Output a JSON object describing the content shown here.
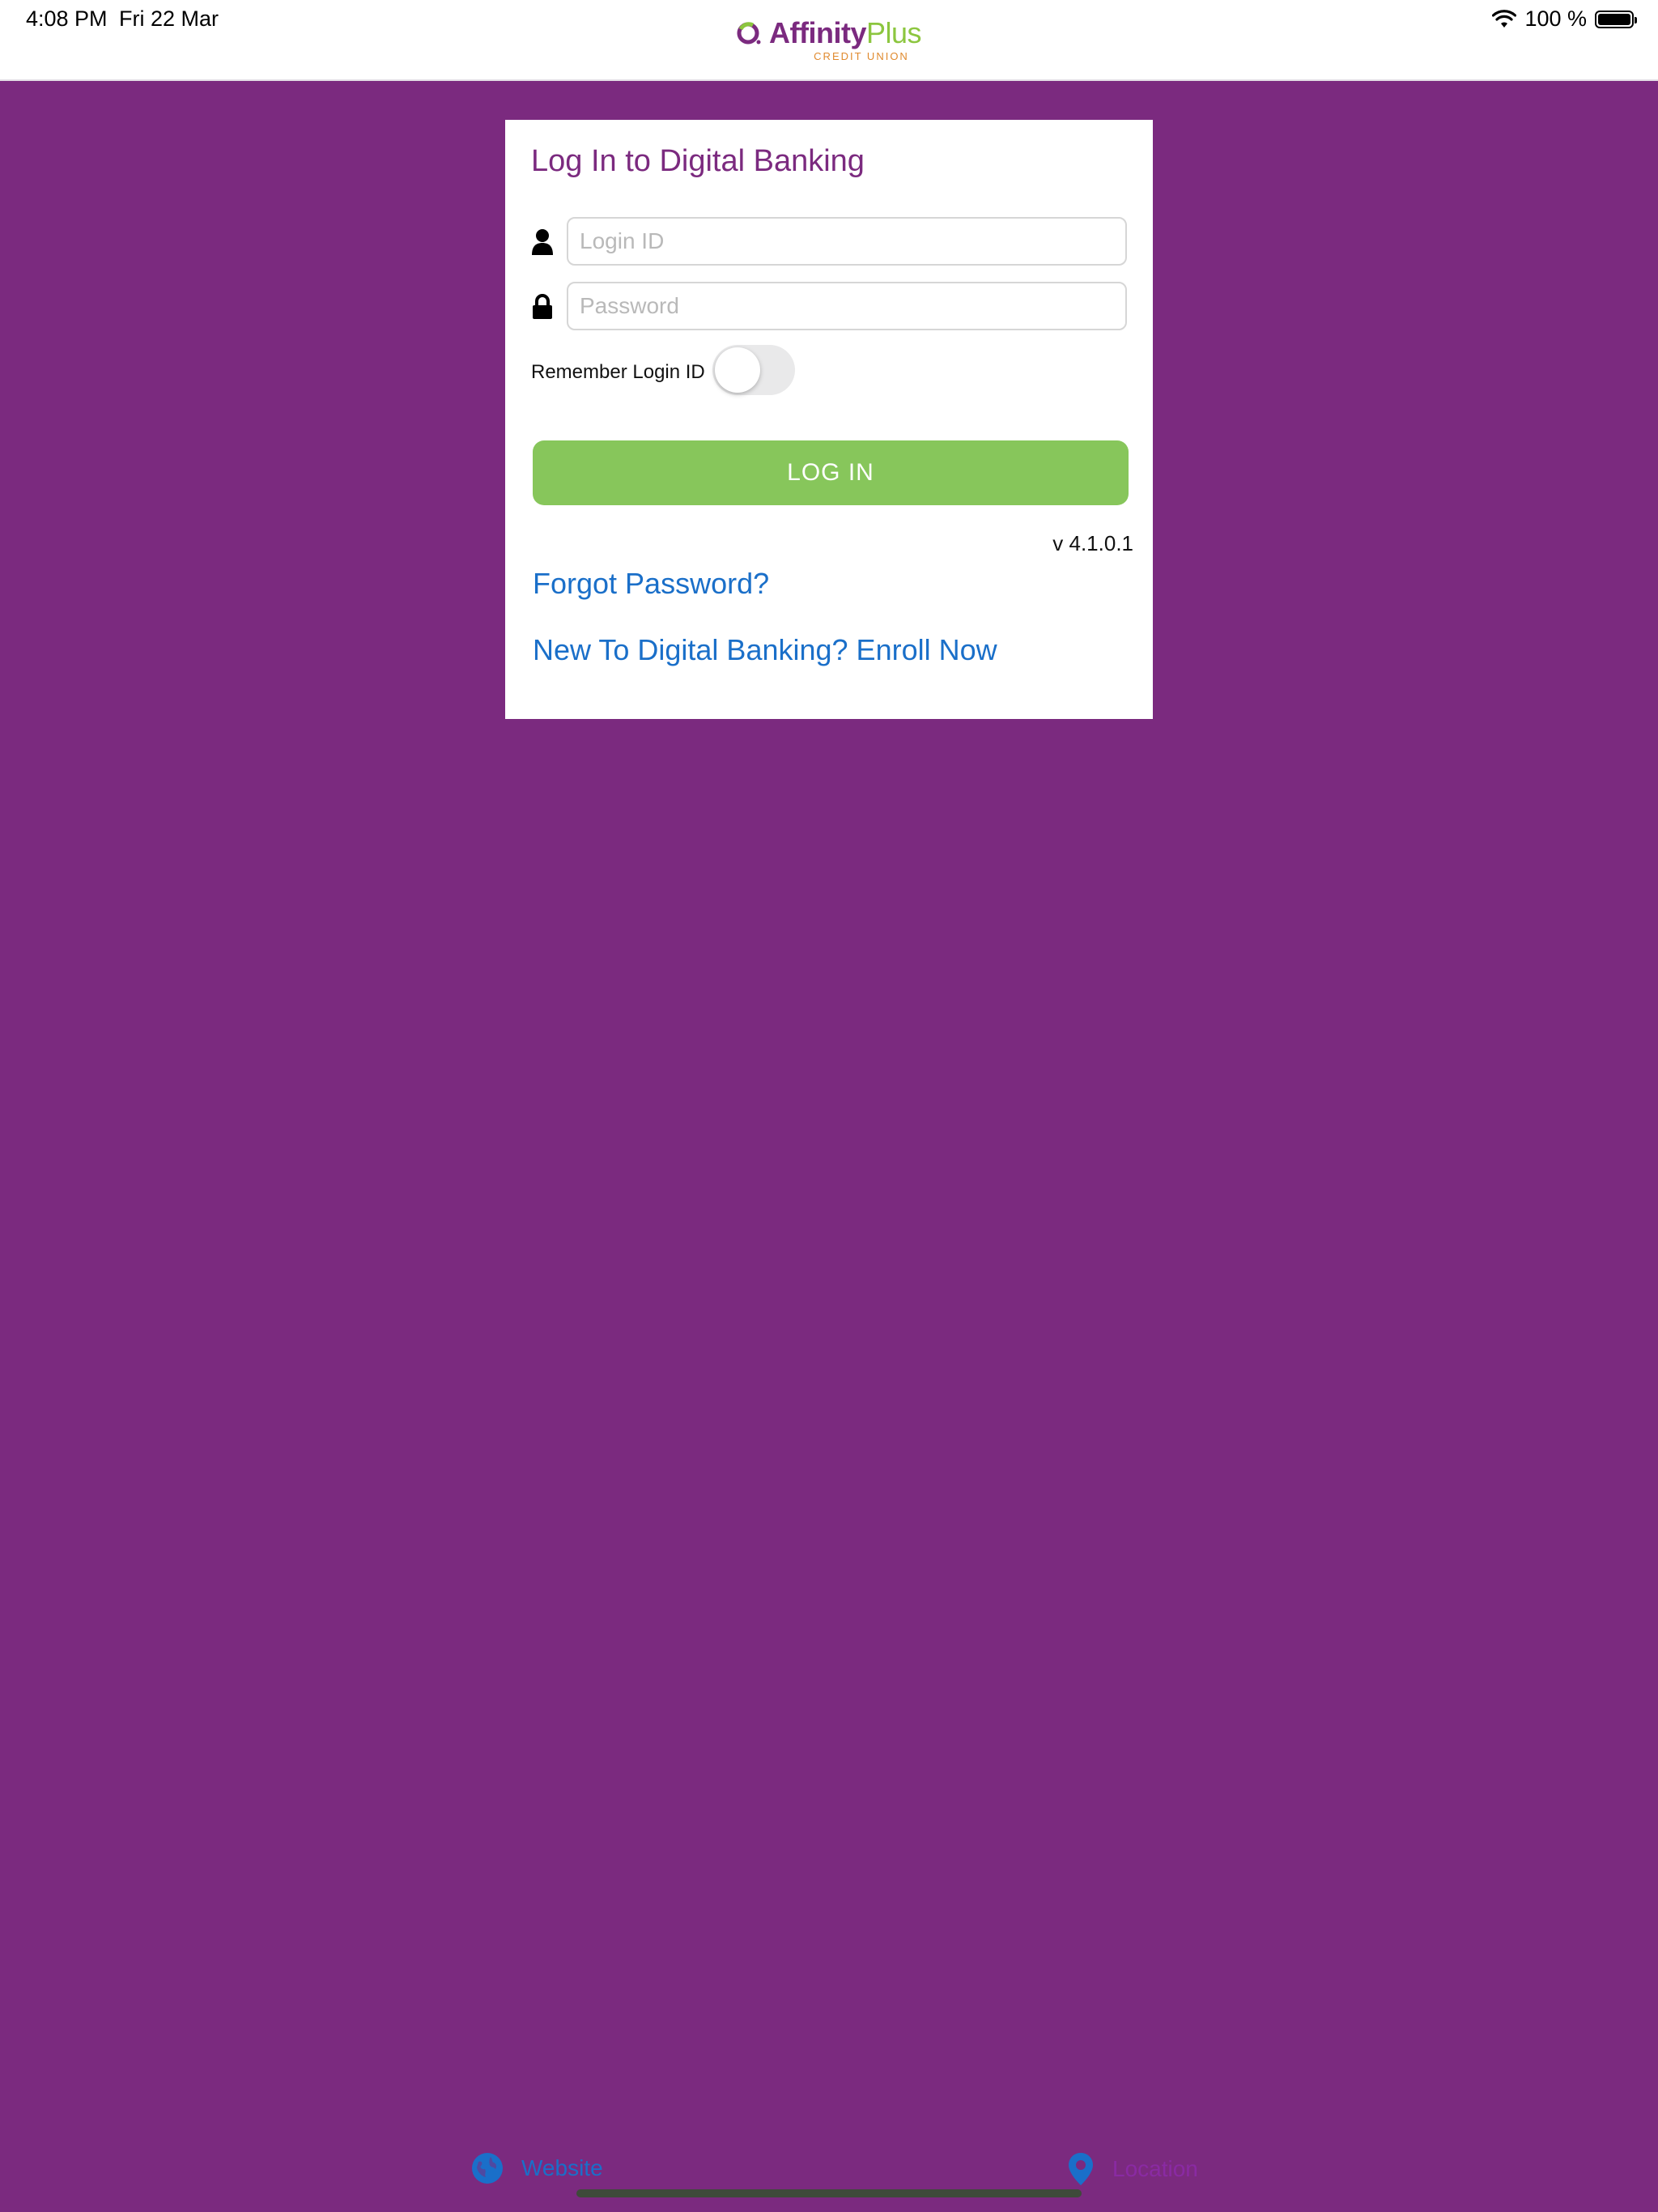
{
  "status_bar": {
    "time": "4:08 PM",
    "date": "Fri 22 Mar",
    "battery": "100 %",
    "icons": [
      "wifi-icon",
      "battery-icon"
    ]
  },
  "header": {
    "logo_word_1": "Affinity",
    "logo_word_2": "Plus",
    "logo_subtitle": "CREDIT UNION"
  },
  "login": {
    "title": "Log In to Digital Banking",
    "login_id_placeholder": "Login ID",
    "login_id_value": "",
    "password_placeholder": "Password",
    "password_value": "",
    "remember_label": "Remember Login ID",
    "remember_enabled": false,
    "login_button": "LOG IN",
    "version": "v 4.1.0.1",
    "forgot_password": "Forgot Password?",
    "enroll": "New To Digital Banking? Enroll Now"
  },
  "footer": {
    "website_label": "Website",
    "location_label": "Location"
  },
  "colors": {
    "background": "#7b2a7f",
    "brand_purple": "#7b2a7f",
    "brand_green": "#87c65b",
    "link_blue": "#1a6fc9"
  }
}
